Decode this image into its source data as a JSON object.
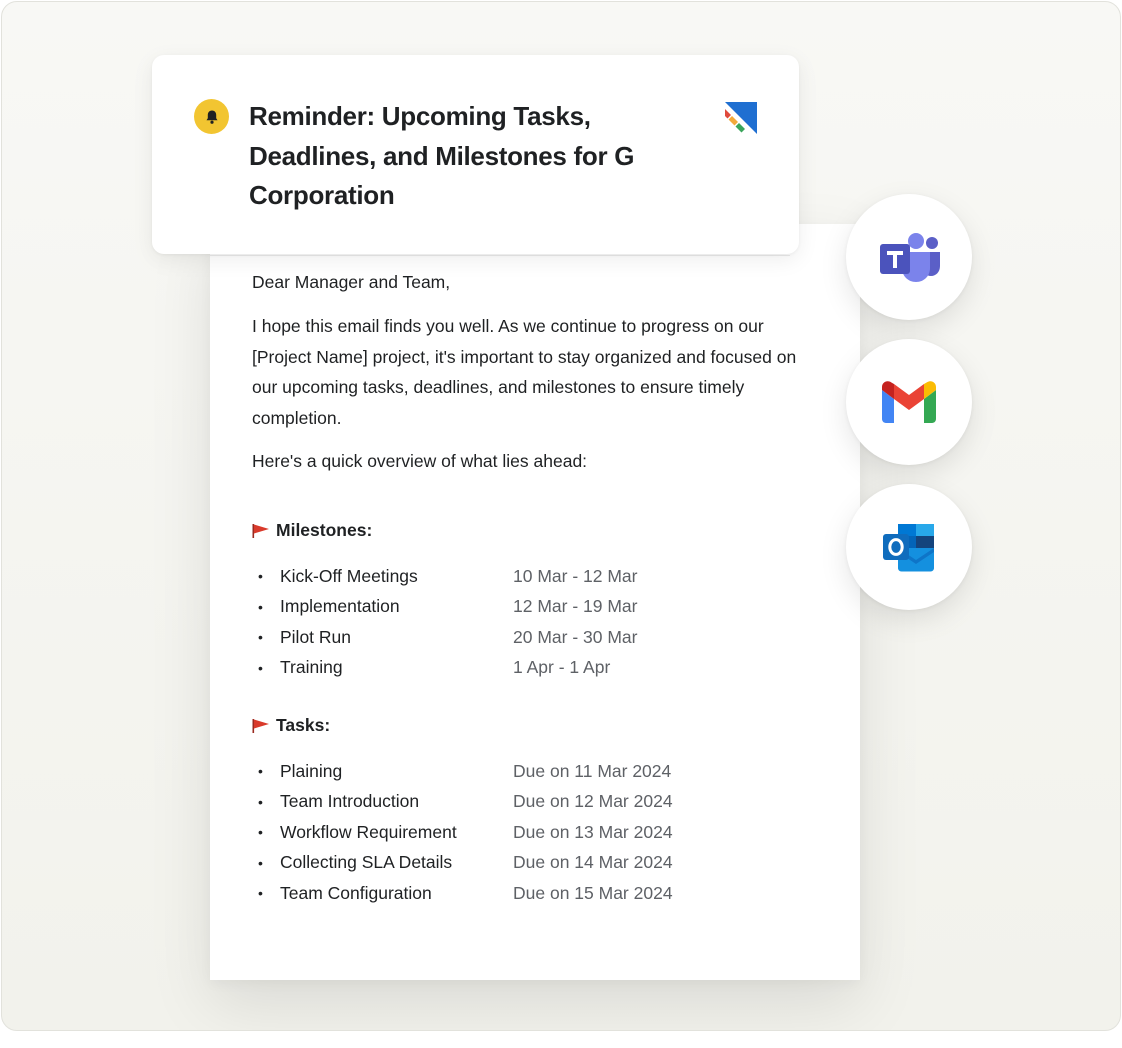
{
  "email": {
    "subject": "Reminder: Upcoming Tasks, Deadlines, and Milestones for G Corporation",
    "greeting": "Dear Manager and Team,",
    "intro": "I hope this email finds you well. As we continue to progress on our [Project Name] project, it's important to stay organized and focused on our upcoming tasks, deadlines, and milestones to ensure timely completion.",
    "overview": "Here's a quick overview of what lies ahead:",
    "milestones": {
      "title": "Milestones:",
      "items": [
        {
          "name": "Kick-Off Meetings",
          "date": "10 Mar - 12 Mar"
        },
        {
          "name": "Implementation",
          "date": "12 Mar - 19 Mar"
        },
        {
          "name": "Pilot Run",
          "date": "20 Mar - 30 Mar"
        },
        {
          "name": "Training",
          "date": "1 Apr - 1 Apr"
        }
      ]
    },
    "tasks": {
      "title": "Tasks:",
      "items": [
        {
          "name": "Plaining",
          "due": "Due on 11 Mar 2024"
        },
        {
          "name": "Team Introduction",
          "due": "Due on 12 Mar 2024"
        },
        {
          "name": "Workflow Requirement",
          "due": "Due on 13 Mar 2024"
        },
        {
          "name": "Collecting SLA Details",
          "due": "Due on 14 Mar 2024"
        },
        {
          "name": "Team Configuration",
          "due": "Due on 15 Mar 2024"
        }
      ]
    },
    "bullet": "•"
  },
  "icons": {
    "bell": "bell-icon",
    "brand": "brand-logo-icon",
    "flag": "flag-icon",
    "teams": "microsoft-teams-icon",
    "gmail": "gmail-icon",
    "outlook": "outlook-icon"
  },
  "colors": {
    "bell_badge": "#f2c531",
    "flag": "#d93a2b",
    "brand_blue": "#1f6fd1"
  }
}
